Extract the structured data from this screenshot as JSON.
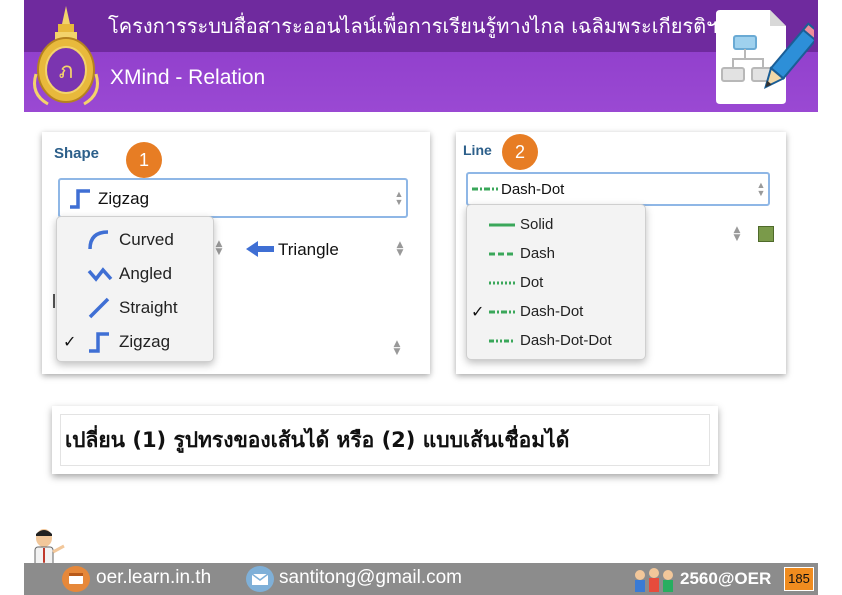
{
  "header": {
    "title": "โครงการระบบสื่อสาระออนไลน์เพื่อการเรียนรู้ทางไกล เฉลิมพระเกียรติฯ",
    "subtitle": "XMind - Relation"
  },
  "shape_panel": {
    "label": "Shape",
    "badge": "1",
    "selected": "Zigzag",
    "arrow_label": "Triangle",
    "options": [
      {
        "label": "Curved",
        "icon": "curve-icon",
        "checked": false
      },
      {
        "label": "Angled",
        "icon": "angled-icon",
        "checked": false
      },
      {
        "label": "Straight",
        "icon": "straight-icon",
        "checked": false
      },
      {
        "label": "Zigzag",
        "icon": "zigzag-icon",
        "checked": true
      }
    ],
    "icon_color": "#3f6fd4"
  },
  "line_panel": {
    "label": "Line",
    "badge": "2",
    "selected": "Dash-Dot",
    "color_swatch": "#7a9a4a",
    "line_color": "#3aa75a",
    "options": [
      {
        "label": "Solid",
        "icon": "solid-line-icon",
        "checked": false
      },
      {
        "label": "Dash",
        "icon": "dash-line-icon",
        "checked": false
      },
      {
        "label": "Dot",
        "icon": "dot-line-icon",
        "checked": false
      },
      {
        "label": "Dash-Dot",
        "icon": "dash-dot-line-icon",
        "checked": true
      },
      {
        "label": "Dash-Dot-Dot",
        "icon": "dash-dot-dot-line-icon",
        "checked": false
      }
    ]
  },
  "caption": "เปลี่ยน (1) รูปทรงของเส้นได้ หรือ (2) แบบเส้นเชื่อมได้",
  "footer": {
    "website": "oer.learn.in.th",
    "email": "santitong@gmail.com",
    "brand": "2560@OER",
    "page": "185"
  }
}
